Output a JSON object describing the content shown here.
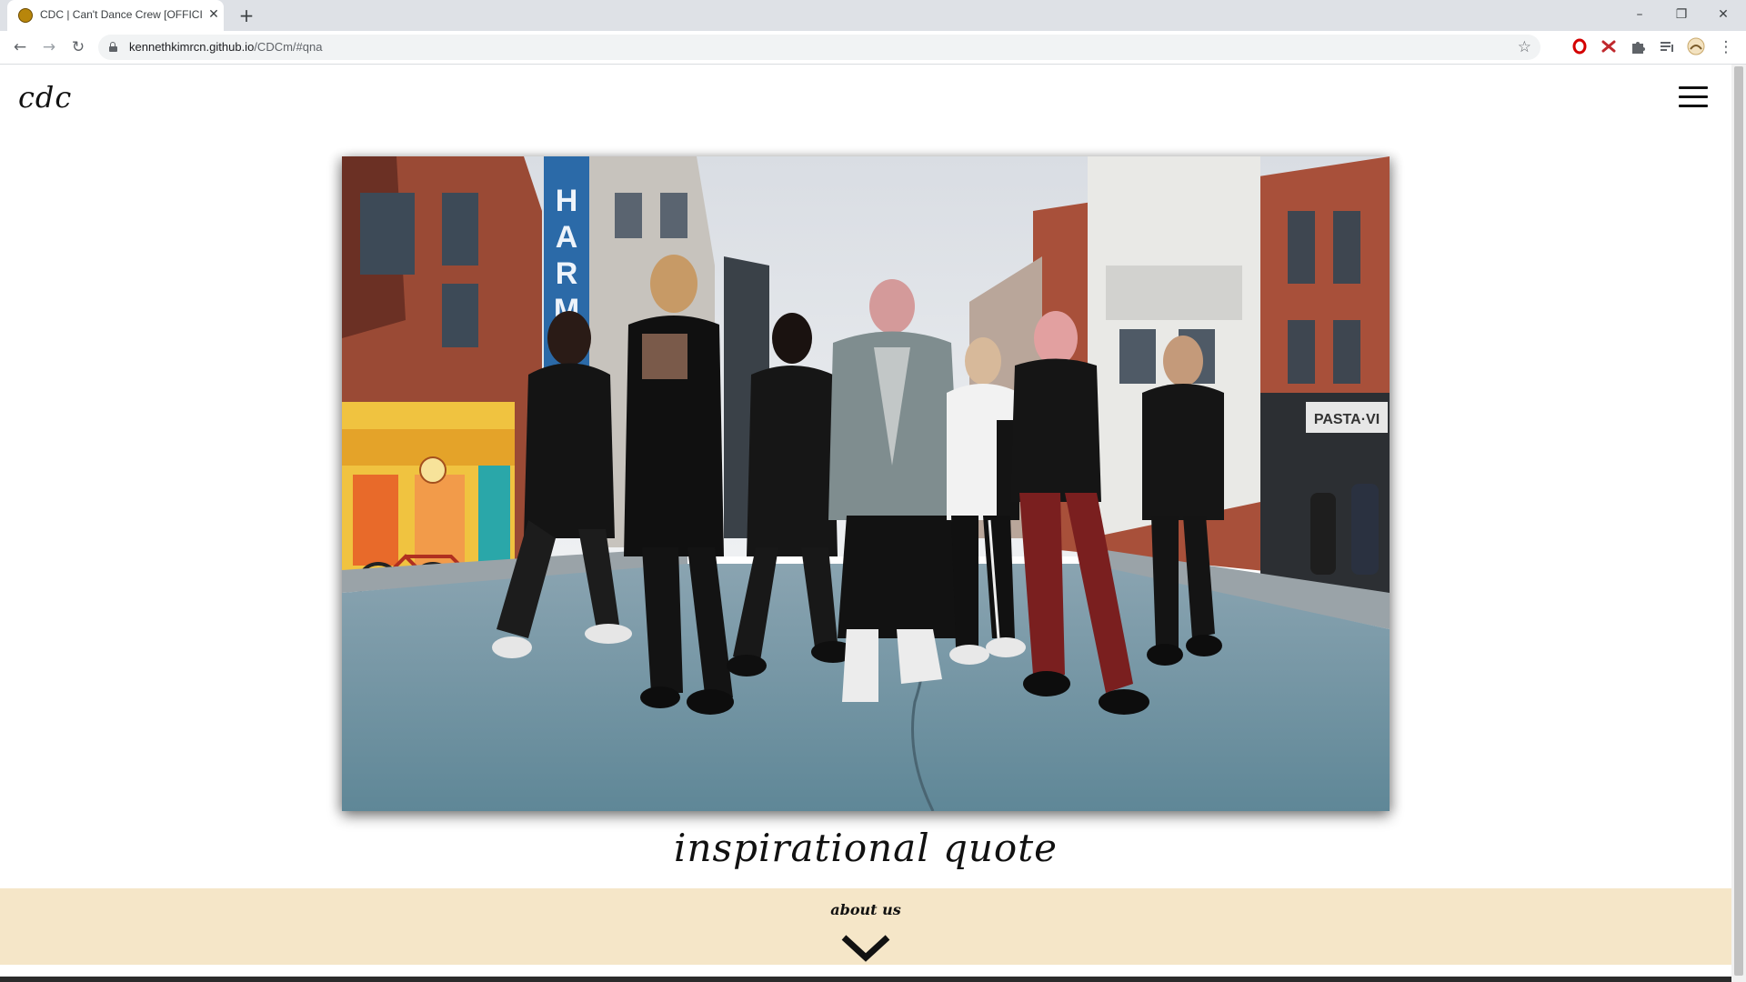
{
  "browser": {
    "tab_title": "CDC | Can't Dance Crew [OFFICIAL]",
    "tab_close": "✕",
    "new_tab": "+",
    "url_host": "kennethkimrcn.github.io",
    "url_path": "/CDCm/#qna",
    "window": {
      "minimize": "–",
      "maximize": "❐",
      "close": "✕"
    },
    "nav": {
      "back": "←",
      "forward": "→",
      "reload": "↻"
    },
    "star": "☆",
    "menu": "⋮"
  },
  "site": {
    "logo": "cdc",
    "quote": "inspirational quote",
    "about_label": "about us"
  },
  "hero": {
    "alt": "Group photo of seven dancers in black streetwear posing on a city street"
  },
  "colors": {
    "about_band": "#f5e6c8",
    "text": "#111111"
  }
}
